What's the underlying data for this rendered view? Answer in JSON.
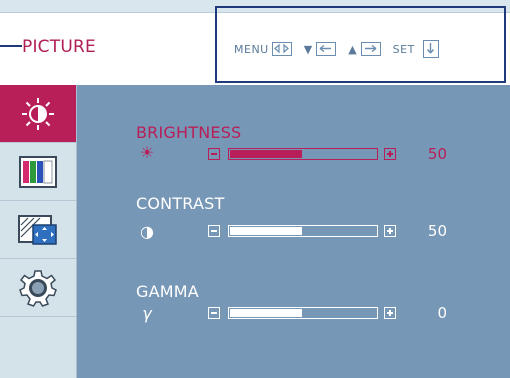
{
  "header": {
    "title": "PICTURE"
  },
  "controls": [
    {
      "label": "MENU",
      "icon": "enter-exit-icon"
    },
    {
      "symbol": "▼",
      "icon": "left-arrow-icon"
    },
    {
      "symbol": "▲",
      "icon": "right-arrow-icon"
    },
    {
      "label": "SET",
      "icon": "down-arrow-icon"
    }
  ],
  "tabs": [
    {
      "name": "picture-tab",
      "icon": "brightness-sun-icon",
      "active": true
    },
    {
      "name": "color-tab",
      "icon": "color-bars-icon",
      "active": false
    },
    {
      "name": "display-tab",
      "icon": "display-position-icon",
      "active": false
    },
    {
      "name": "settings-tab",
      "icon": "gear-icon",
      "active": false
    }
  ],
  "rows": [
    {
      "label": "BRIGHTNESS",
      "icon_glyph": "☀",
      "value": "50",
      "level_percent": 50,
      "active": true
    },
    {
      "label": "CONTRAST",
      "icon_glyph": "◑",
      "value": "50",
      "level_percent": 50,
      "active": false
    },
    {
      "label": "GAMMA",
      "icon_glyph": "γ",
      "value": "0",
      "level_percent": 50,
      "active": false
    }
  ],
  "colors": {
    "accent": "#b81f58",
    "panel": "#7797b6",
    "callout": "#1f3a7a"
  }
}
